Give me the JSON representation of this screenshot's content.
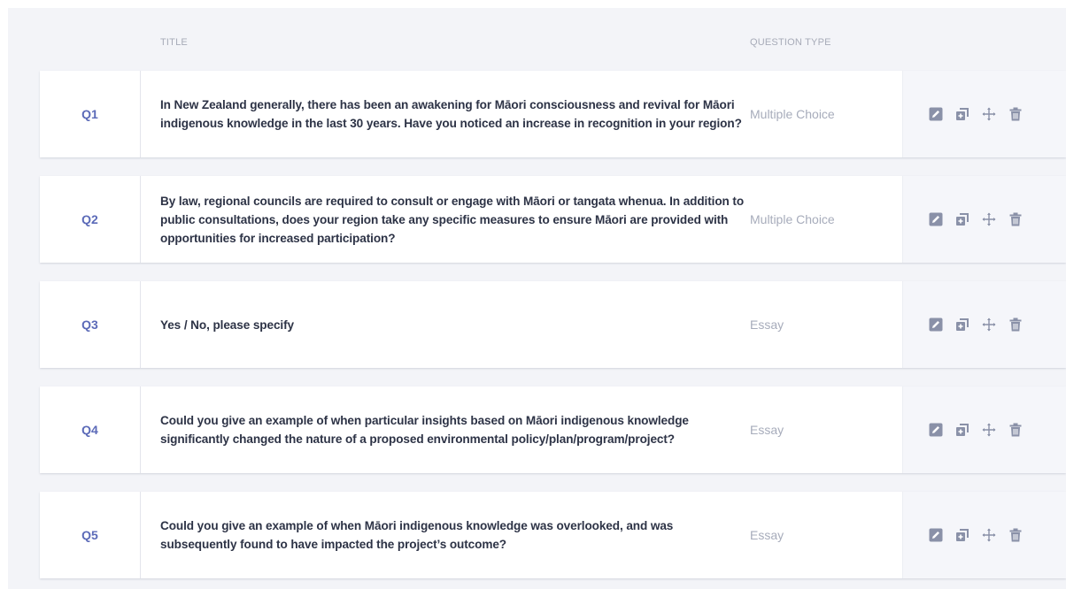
{
  "header": {
    "title_col": "TITLE",
    "type_col": "QUESTION TYPE"
  },
  "questions": [
    {
      "number": "Q1",
      "title": "In New Zealand generally, there has been an awakening for Māori consciousness and revival for Māori indigenous knowledge in the last 30 years. Have you noticed an increase in recognition in your region?",
      "type": "Multiple Choice"
    },
    {
      "number": "Q2",
      "title": "By law, regional councils are required to consult or engage with Māori or tangata whenua. In addition to public consultations, does your region take any specific measures to ensure Māori are provided with opportunities for increased participation?",
      "type": "Multiple Choice"
    },
    {
      "number": "Q3",
      "title": "Yes / No, please specify",
      "type": "Essay"
    },
    {
      "number": "Q4",
      "title": "Could you give an example of when particular insights based on Māori indigenous knowledge significantly changed the nature of a proposed environmental policy/plan/program/project?",
      "type": "Essay"
    },
    {
      "number": "Q5",
      "title": "Could you give an example of when Māori indigenous knowledge was overlooked, and was subsequently found to have impacted the project’s outcome?",
      "type": "Essay"
    }
  ],
  "actions": [
    "edit-icon",
    "duplicate-icon",
    "move-icon",
    "delete-icon"
  ],
  "colors": {
    "accent": "#5b6ab8",
    "icon": "#8a91a8",
    "background": "#f3f4f8",
    "title_text": "#2d3346",
    "muted_text": "#a7acbb"
  }
}
